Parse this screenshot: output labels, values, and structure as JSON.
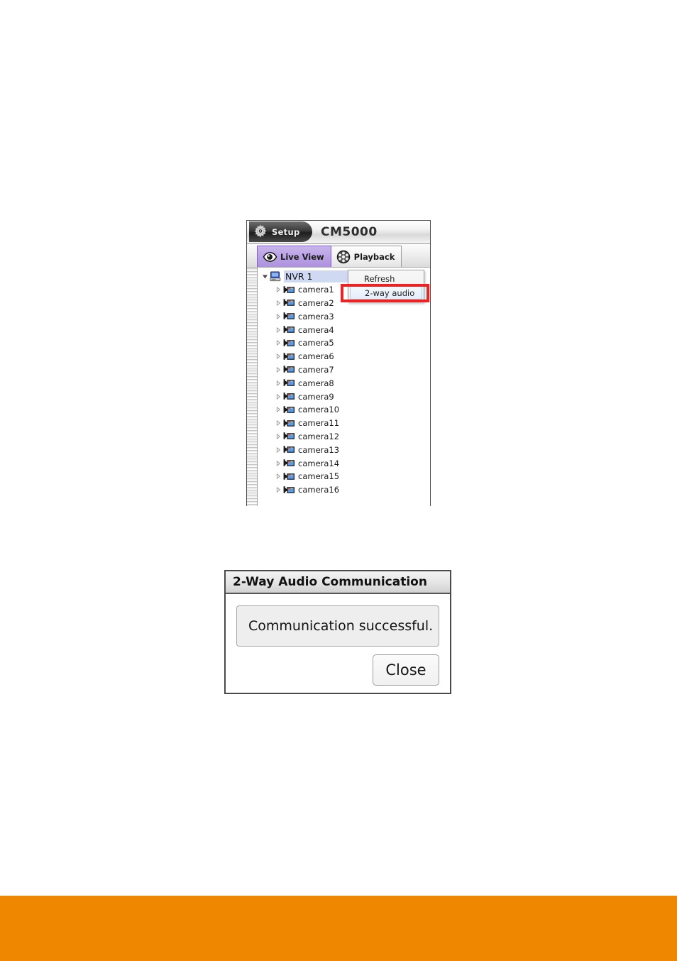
{
  "app": {
    "title": "CM5000",
    "setup_button_label": "Setup",
    "setup_icon": "gear-icon"
  },
  "tabs": [
    {
      "label": "Live View",
      "icon": "eye-icon",
      "active": true
    },
    {
      "label": "Playback",
      "icon": "film-reel-icon",
      "active": false
    }
  ],
  "tree": {
    "root": {
      "label": "NVR 1",
      "icon": "nvr-server-icon",
      "selected": true,
      "expander": "expanded-triangle"
    },
    "children": [
      {
        "label": "camera1",
        "icon": "camcorder-icon"
      },
      {
        "label": "camera2",
        "icon": "camcorder-icon"
      },
      {
        "label": "camera3",
        "icon": "camcorder-icon"
      },
      {
        "label": "camera4",
        "icon": "camcorder-icon"
      },
      {
        "label": "camera5",
        "icon": "camcorder-icon"
      },
      {
        "label": "camera6",
        "icon": "camcorder-icon"
      },
      {
        "label": "camera7",
        "icon": "camcorder-icon"
      },
      {
        "label": "camera8",
        "icon": "camcorder-icon"
      },
      {
        "label": "camera9",
        "icon": "camcorder-icon"
      },
      {
        "label": "camera10",
        "icon": "camcorder-icon"
      },
      {
        "label": "camera11",
        "icon": "camcorder-icon"
      },
      {
        "label": "camera12",
        "icon": "camcorder-icon"
      },
      {
        "label": "camera13",
        "icon": "camcorder-icon"
      },
      {
        "label": "camera14",
        "icon": "camcorder-icon"
      },
      {
        "label": "camera15",
        "icon": "camcorder-icon"
      },
      {
        "label": "camera16",
        "icon": "camcorder-icon"
      }
    ]
  },
  "context_menu": {
    "items": [
      {
        "label": "Refresh",
        "highlighted": false
      },
      {
        "label": "2-way audio",
        "highlighted": true
      }
    ],
    "callout_color": "#ee2222"
  },
  "dialog": {
    "title": "2-Way Audio Communication",
    "message": "Communication successful.",
    "close_label": "Close"
  },
  "footer": {
    "color": "#ef8700"
  }
}
